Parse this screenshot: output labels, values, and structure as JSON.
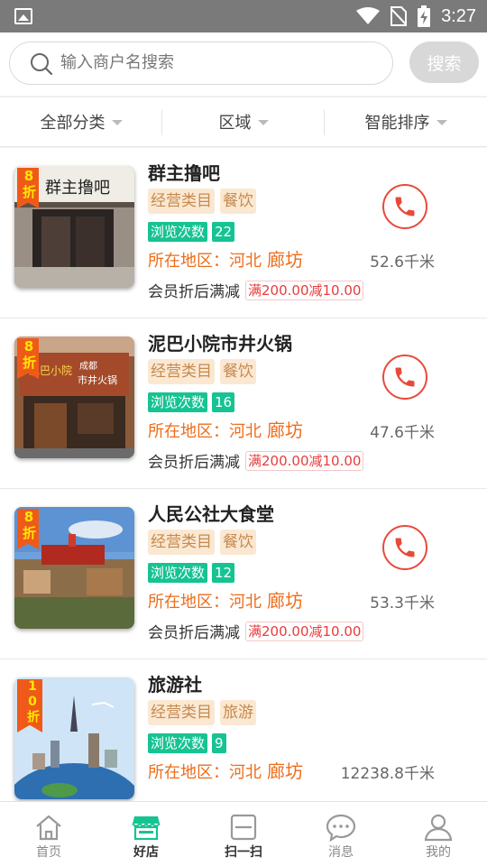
{
  "status_bar": {
    "time": "3:27",
    "icons": [
      "image-icon",
      "wifi-icon",
      "no-sim-icon",
      "battery-charging-icon"
    ]
  },
  "search": {
    "placeholder": "输入商户名搜索",
    "value": "",
    "button_label": "搜索"
  },
  "filters": [
    {
      "label": "全部分类"
    },
    {
      "label": "区域"
    },
    {
      "label": "智能排序"
    }
  ],
  "shops": [
    {
      "name": "群主撸吧",
      "discount": "8折",
      "category_label": "经营类目",
      "category": "餐饮",
      "views_label": "浏览次数",
      "views": "22",
      "region_label": "所在地区：",
      "province": "河北",
      "city": "廊坊",
      "promo_label": "会员折后满减",
      "promo": "满200.00减10.00",
      "distance": "52.6千米"
    },
    {
      "name": "泥巴小院市井火锅",
      "discount": "8折",
      "category_label": "经营类目",
      "category": "餐饮",
      "views_label": "浏览次数",
      "views": "16",
      "region_label": "所在地区：",
      "province": "河北",
      "city": "廊坊",
      "promo_label": "会员折后满减",
      "promo": "满200.00减10.00",
      "distance": "47.6千米"
    },
    {
      "name": "人民公社大食堂",
      "discount": "8折",
      "category_label": "经营类目",
      "category": "餐饮",
      "views_label": "浏览次数",
      "views": "12",
      "region_label": "所在地区：",
      "province": "河北",
      "city": "廊坊",
      "promo_label": "会员折后满减",
      "promo": "满200.00减10.00",
      "distance": "53.3千米"
    },
    {
      "name": "旅游社",
      "discount": "10折",
      "category_label": "经营类目",
      "category": "旅游",
      "views_label": "浏览次数",
      "views": "9",
      "region_label": "所在地区：",
      "province": "河北",
      "city": "廊坊",
      "promo_label": "",
      "promo": "",
      "distance": "12238.8千米"
    }
  ],
  "tabbar": {
    "items": [
      {
        "label": "首页",
        "icon": "home-icon"
      },
      {
        "label": "好店",
        "icon": "store-icon",
        "active": true
      },
      {
        "label": "扫一扫",
        "icon": "scan-icon"
      },
      {
        "label": "消息",
        "icon": "message-icon"
      },
      {
        "label": "我的",
        "icon": "user-icon"
      }
    ]
  },
  "colors": {
    "accent_orange": "#ee6c1a",
    "badge_green": "#16c392",
    "active_tab": "#16c392",
    "phone_red": "#e84a3a"
  }
}
